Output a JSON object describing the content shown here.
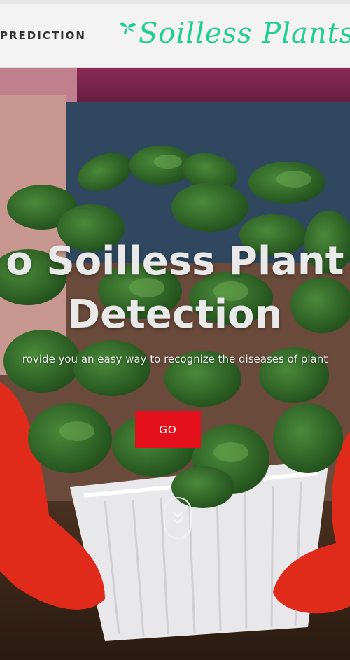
{
  "header": {
    "nav_link": "PREDICTION",
    "brand_name": "Soilless Plants",
    "brand_color": "#1fcf8f"
  },
  "hero": {
    "title_line1": "o Soilless Plant",
    "title_line2": "Detection",
    "subtitle": "rovide you an easy way to recognize the diseases of plant",
    "go_label": "GO",
    "go_color": "#e3101b",
    "scroll_icon": "chevron-double-down-icon"
  }
}
